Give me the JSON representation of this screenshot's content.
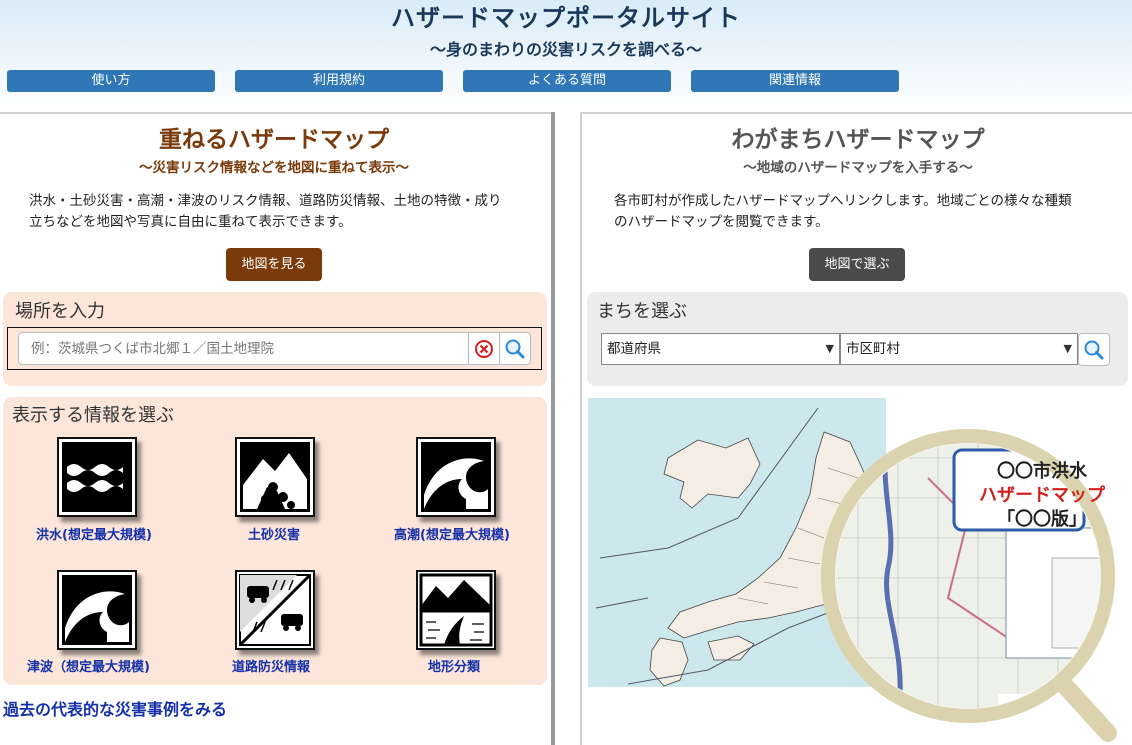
{
  "header": {
    "title": "ハザードマップポータルサイト",
    "subtitle": "〜身のまわりの災害リスクを調べる〜"
  },
  "nav": [
    {
      "label": "使い方"
    },
    {
      "label": "利用規約"
    },
    {
      "label": "よくある質問"
    },
    {
      "label": "関連情報"
    }
  ],
  "left": {
    "title": "重ねるハザードマップ",
    "subtitle": "〜災害リスク情報などを地図に重ねて表示〜",
    "description_line1": "洪水・土砂災害・高潮・津波のリスク情報、道路防災情報、土地の特徴・成り",
    "description_line2": "立ちなどを地図や写真に自由に重ねて表示できます。",
    "map_button": "地図を見る",
    "location_title": "場所を入力",
    "search_placeholder": "例：茨城県つくば市北郷１／国土地理院",
    "info_title": "表示する情報を選ぶ",
    "info_items": [
      {
        "label": "洪水(想定最大規模)",
        "icon": "flood-icon"
      },
      {
        "label": "土砂災害",
        "icon": "landslide-icon"
      },
      {
        "label": "高潮(想定最大規模)",
        "icon": "storm-surge-icon"
      },
      {
        "label": "津波（想定最大規模)",
        "icon": "tsunami-icon"
      },
      {
        "label": "道路防災情報",
        "icon": "road-disaster-icon"
      },
      {
        "label": "地形分類",
        "icon": "terrain-icon"
      }
    ],
    "past_link": "過去の代表的な災害事例をみる"
  },
  "right": {
    "title": "わがまちハザードマップ",
    "subtitle": "〜地域のハザードマップを入手する〜",
    "description_line1": "各市町村が作成したハザードマップへリンクします。地域ごとの様々な種類",
    "description_line2": "のハザードマップを閲覧できます。",
    "map_button": "地図で選ぶ",
    "select_title": "まちを選ぶ",
    "prefecture_select": "都道府県",
    "city_select": "市区町村",
    "magnifier_line1": "〇〇市洪水",
    "magnifier_line2": "ハザードマップ",
    "magnifier_line3": "「〇〇版」"
  },
  "colors": {
    "nav_blue": "#2f77b7",
    "left_accent": "#7a3a0a",
    "left_box_bg": "#fce6da",
    "right_box_bg": "#ececec",
    "right_button": "#4a4a4a",
    "link_blue": "#1530a8"
  }
}
